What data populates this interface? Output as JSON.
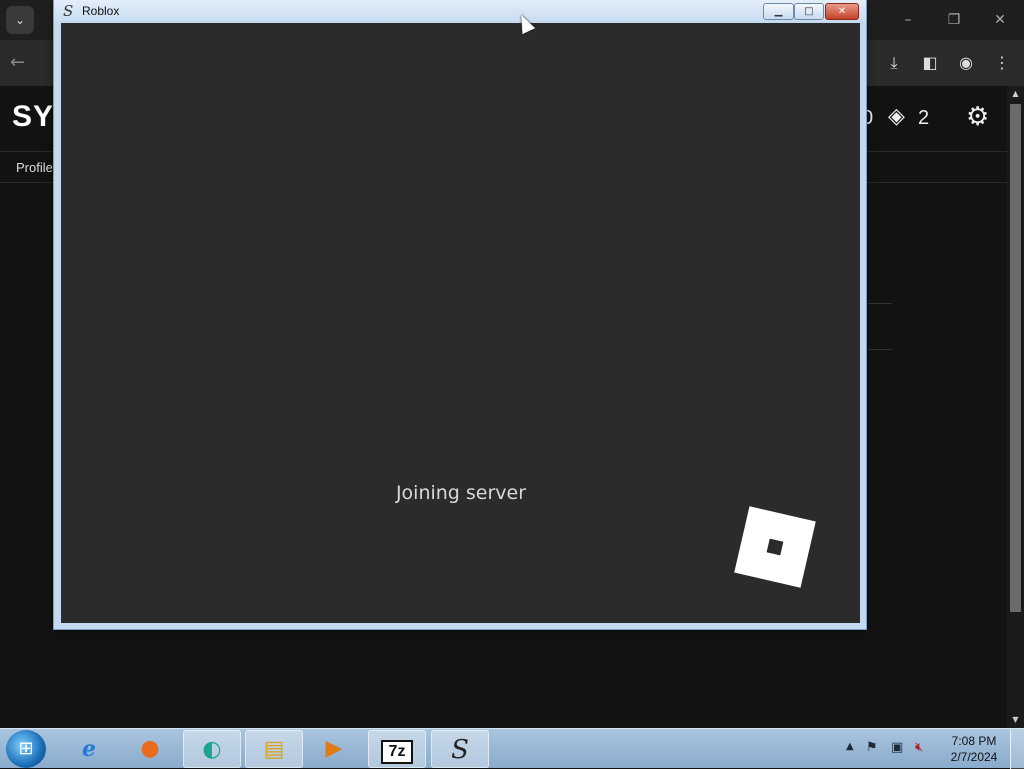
{
  "browser": {
    "site_logo": "SY",
    "nav_profile": "Profile",
    "robux_count": "0",
    "tix_count": "2"
  },
  "roblox_window": {
    "title": "Roblox",
    "status_text": "Joining server"
  },
  "taskbar": {
    "clock_time": "7:08 PM",
    "clock_date": "2/7/2024",
    "apps": [
      "internet-explorer",
      "firefox",
      "edge",
      "file-explorer",
      "media-player",
      "7-zip",
      "roblox"
    ]
  },
  "colors": {
    "client_bg": "#2b2b2b",
    "browser_bg": "#121212",
    "taskbar": "#a9c4de"
  }
}
